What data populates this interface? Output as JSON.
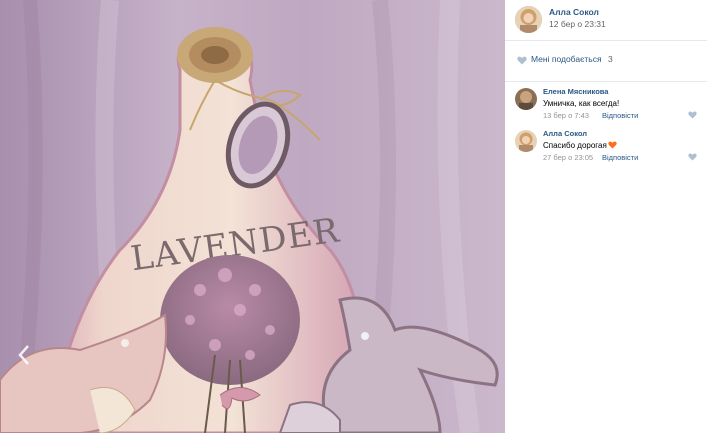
{
  "post": {
    "author": "Алла Сокол",
    "time": "12 бер о 23:31"
  },
  "photo": {
    "board_text": "LAVENDER"
  },
  "likes": {
    "label": "Мені подобається",
    "count": "3"
  },
  "comments": [
    {
      "author": "Елена Мясникова",
      "text": "Умничка, как всегда!",
      "time": "13 бер о 7:43",
      "reply_label": "Відповісти"
    },
    {
      "author": "Алла Сокол",
      "text": "Спасибо дорогая",
      "emoji": "orange-heart-emoji",
      "time": "27 бер о 23:05",
      "reply_label": "Відповісти"
    }
  ],
  "colors": {
    "link": "#2a5885",
    "muted": "#939393",
    "divider": "#e7e8ec",
    "heart_inactive": "#aebfd1",
    "emoji_heart": "#ff6d1f"
  },
  "icons": {
    "prev": "chevron-left-icon",
    "like": "heart-icon"
  }
}
